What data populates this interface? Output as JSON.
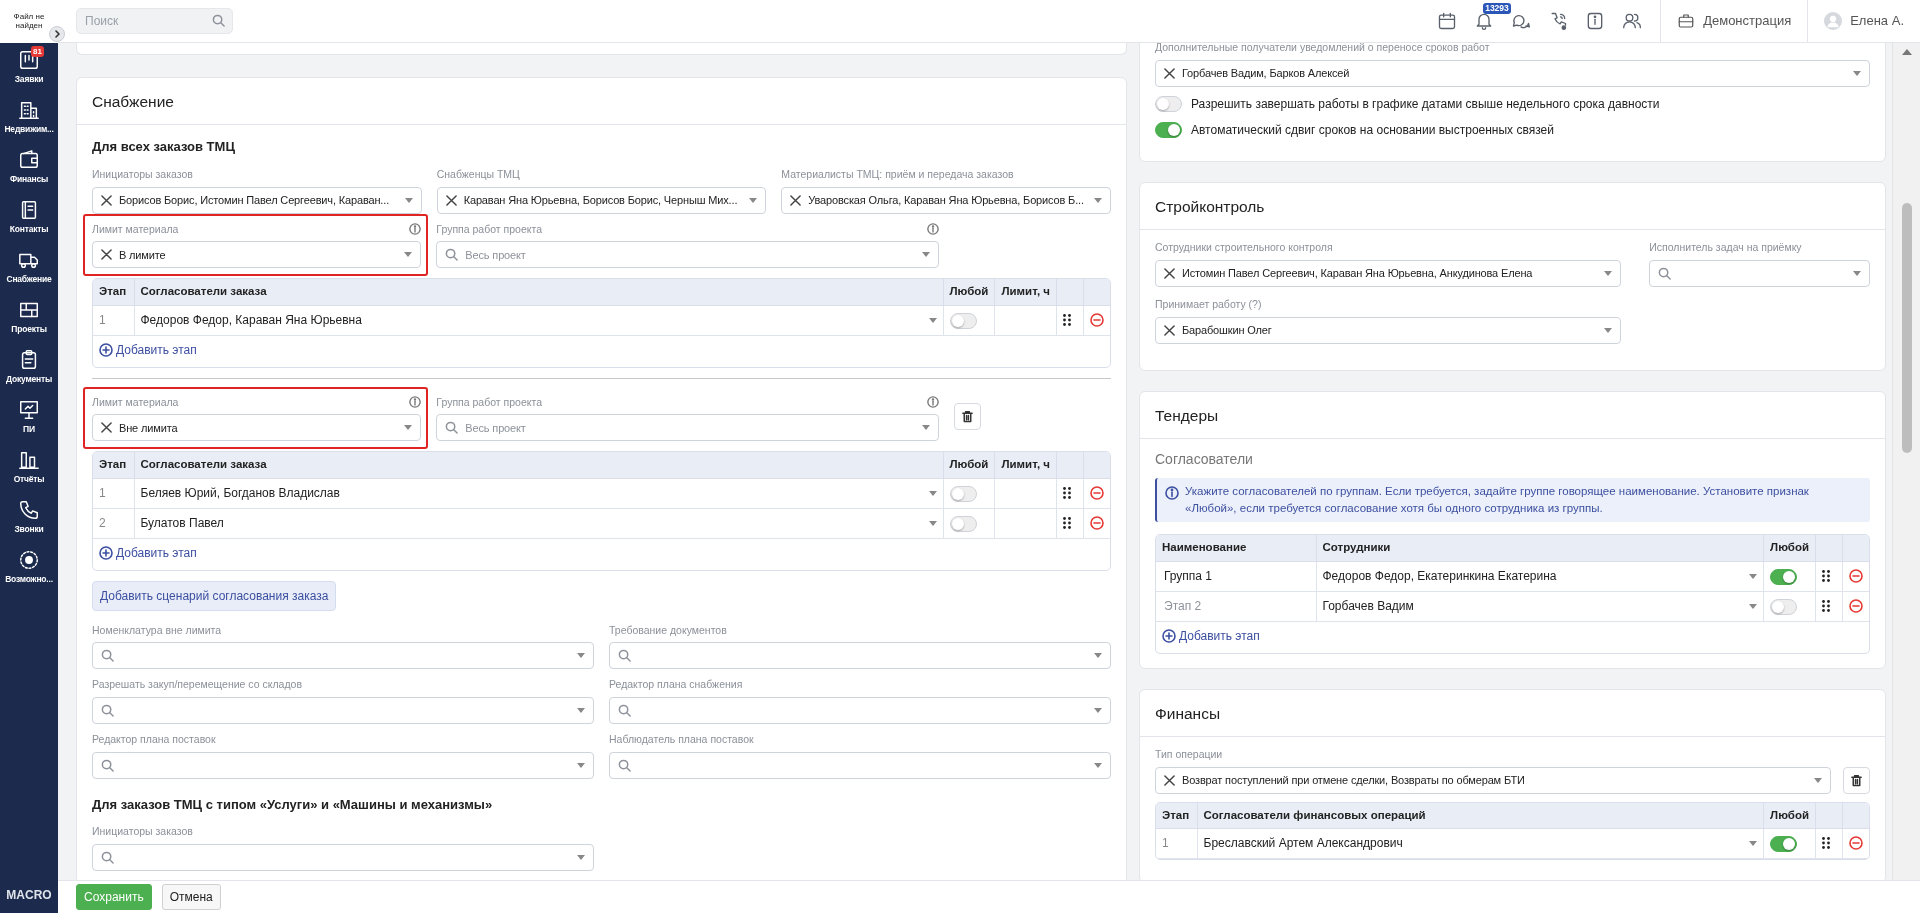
{
  "sidebar": {
    "logo_text": "Файл не найден",
    "items": [
      {
        "label": "Заявки",
        "badge": "81"
      },
      {
        "label": "Недвижим..."
      },
      {
        "label": "Финансы"
      },
      {
        "label": "Контакты"
      },
      {
        "label": "Снабжение"
      },
      {
        "label": "Проекты"
      },
      {
        "label": "Документы"
      },
      {
        "label": "ПИ"
      },
      {
        "label": "Отчёты"
      },
      {
        "label": "Звонки"
      },
      {
        "label": "Возможно..."
      }
    ],
    "brand": "MACRO"
  },
  "topbar": {
    "search": {
      "placeholder": "Поиск"
    },
    "notifications_badge": "13293",
    "workspace": "Демонстрация",
    "user": "Елена А."
  },
  "supply": {
    "title": "Снабжение",
    "heading": "Для всех заказов ТМЦ",
    "fields": [
      {
        "label": "Инициаторы заказов",
        "value": "Борисов Борис, Истомин Павел Сергеевич, Караван..."
      },
      {
        "label": "Снабженцы ТМЦ",
        "value": "Караван Яна Юрьевна, Борисов Борис, Черныш Мих..."
      },
      {
        "label": "Материалисты ТМЦ: приём и передача заказов",
        "value": "Уваровская Ольга, Караван Яна Юрьевна, Борисов Б..."
      }
    ],
    "scenarios": [
      {
        "highlighted": true,
        "deletable": false,
        "limit": {
          "label": "Лимит материала",
          "value": "В лимите"
        },
        "group": {
          "label": "Группа работ проекта",
          "placeholder": "Весь проект"
        },
        "table": {
          "columns": [
            "Этап",
            "Согласователи заказа",
            "Любой",
            "Лимит, ч"
          ],
          "rows": [
            {
              "stage": "1",
              "approvers": "Федоров Федор, Караван Яна Юрьевна",
              "any": false
            }
          ],
          "add": "Добавить этап"
        }
      },
      {
        "highlighted": true,
        "deletable": true,
        "limit": {
          "label": "Лимит материала",
          "value": "Вне лимита"
        },
        "group": {
          "label": "Группа работ проекта",
          "placeholder": "Весь проект"
        },
        "table": {
          "columns": [
            "Этап",
            "Согласователи заказа",
            "Любой",
            "Лимит, ч"
          ],
          "rows": [
            {
              "stage": "1",
              "approvers": "Беляев Юрий, Богданов Владислав",
              "any": false
            },
            {
              "stage": "2",
              "approvers": "Булатов Павел",
              "any": false
            }
          ],
          "add": "Добавить этап"
        }
      }
    ],
    "add_scenario": "Добавить сценарий согласования заказа",
    "extra_fields": [
      {
        "label": "Номенклатура вне лимита"
      },
      {
        "label": "Требование документов"
      },
      {
        "label": "Разрешать закуп/перемещение со складов"
      },
      {
        "label": "Редактор плана снабжения"
      },
      {
        "label": "Редактор плана поставок"
      },
      {
        "label": "Наблюдатель плана поставок"
      }
    ],
    "services": {
      "heading": "Для заказов ТМЦ с типом «Услуги» и «Машины и механизмы»",
      "fields": [
        {
          "label": "Инициаторы заказов"
        }
      ]
    }
  },
  "notifications": {
    "field": {
      "label": "Дополнительные получатели уведомлений о переносе сроков работ",
      "value": "Горбачев Вадим, Барков Алексей"
    },
    "toggles": [
      {
        "label": "Разрешить завершать работы в графике датами свыше недельного срока давности",
        "on": false
      },
      {
        "label": "Автоматический сдвиг сроков на основании выстроенных связей",
        "on": true
      }
    ]
  },
  "construction_control": {
    "title": "Стройконтроль",
    "fields": [
      {
        "label": "Сотрудники строительного контроля",
        "value": "Истомин Павел Сергеевич, Караван Яна Юрьевна, Анкудинова Елена"
      },
      {
        "label": "Исполнитель задач на приёмку"
      },
      {
        "label": "Принимает работу (?)",
        "value": "Барабошкин Олег"
      }
    ]
  },
  "tenders": {
    "title": "Тендеры",
    "subtitle": "Согласователи",
    "info": "Укажите согласователей по группам. Если требуется, задайте группе говорящее наименование. Установите признак «Любой», если требуется согласование хотя бы одного сотрудника из группы.",
    "table": {
      "columns": [
        "Наименование",
        "Сотрудники",
        "Любой"
      ],
      "rows": [
        {
          "name": "Группа 1",
          "staff": "Федоров Федор, Екатеринкина Екатерина",
          "any": true
        },
        {
          "name_placeholder": "Этап 2",
          "staff": "Горбачев Вадим",
          "any": false
        }
      ],
      "add": "Добавить этап"
    }
  },
  "finance": {
    "title": "Финансы",
    "field": {
      "label": "Тип операции",
      "value": "Возврат поступлений при отмене сделки, Возвраты по обмерам БТИ"
    },
    "table": {
      "columns": [
        "Этап",
        "Согласователи финансовых операций",
        "Любой"
      ],
      "rows": [
        {
          "stage": "1",
          "approvers": "Бреславский Артем Александрович",
          "any": true
        }
      ]
    }
  },
  "footer": {
    "buttons": [
      {
        "label": "Сохранить",
        "kind": "primary"
      },
      {
        "label": "Отмена",
        "kind": "secondary"
      }
    ]
  }
}
